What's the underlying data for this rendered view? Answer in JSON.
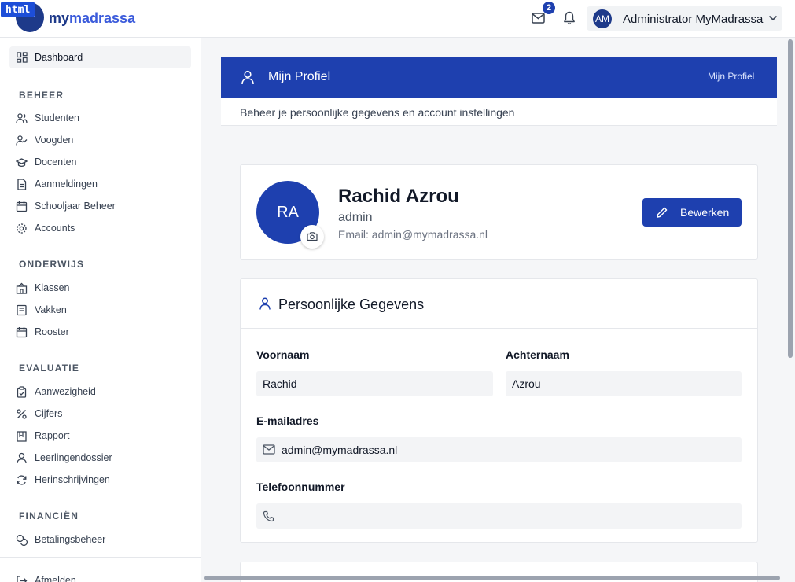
{
  "badge": {
    "label": "html"
  },
  "brand": {
    "prefix": "my",
    "name": "madrassa"
  },
  "topbar": {
    "mail_count": "2",
    "user_initials": "AM",
    "user_name": "Administrator MyMadrassa"
  },
  "sidebar": {
    "dashboard": "Dashboard",
    "sections": [
      {
        "title": "BEHEER",
        "items": [
          "Studenten",
          "Voogden",
          "Docenten",
          "Aanmeldingen",
          "Schooljaar Beheer",
          "Accounts"
        ]
      },
      {
        "title": "ONDERWIJS",
        "items": [
          "Klassen",
          "Vakken",
          "Rooster"
        ]
      },
      {
        "title": "EVALUATIE",
        "items": [
          "Aanwezigheid",
          "Cijfers",
          "Rapport",
          "Leerlingendossier",
          "Herinschrijvingen"
        ]
      },
      {
        "title": "FINANCIËN",
        "items": [
          "Betalingsbeheer"
        ]
      }
    ],
    "logout": "Afmelden"
  },
  "page": {
    "title": "Mijn Profiel",
    "breadcrumb": "Mijn Profiel",
    "subtitle": "Beheer je persoonlijke gegevens en account instellingen"
  },
  "profile": {
    "initials": "RA",
    "name": "Rachid Azrou",
    "role": "admin",
    "email_line": "Email: admin@mymadrassa.nl",
    "edit_label": "Bewerken"
  },
  "personal": {
    "title": "Persoonlijke Gegevens",
    "first_name_label": "Voornaam",
    "first_name": "Rachid",
    "last_name_label": "Achternaam",
    "last_name": "Azrou",
    "email_label": "E-mailadres",
    "email": "admin@mymadrassa.nl",
    "phone_label": "Telefoonnummer",
    "phone": ""
  },
  "colors": {
    "primary": "#1e40af",
    "sidebar_bg": "#ffffff",
    "page_bg": "#f5f6f8"
  }
}
